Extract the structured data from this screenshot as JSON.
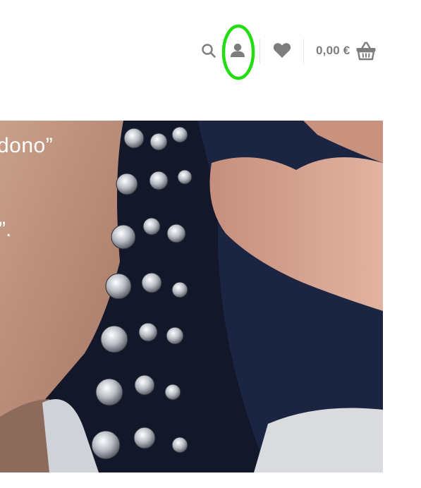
{
  "header": {
    "cart_total": "0,00 €",
    "icons": {
      "search": "search-icon",
      "account": "user-icon",
      "wishlist": "heart-icon",
      "cart": "basket-icon"
    },
    "icon_color": "#7d7d7d",
    "highlight_color": "#22dd11"
  },
  "hero": {
    "quote_fragment": "dono”",
    "quote_fragment_2": "”."
  }
}
